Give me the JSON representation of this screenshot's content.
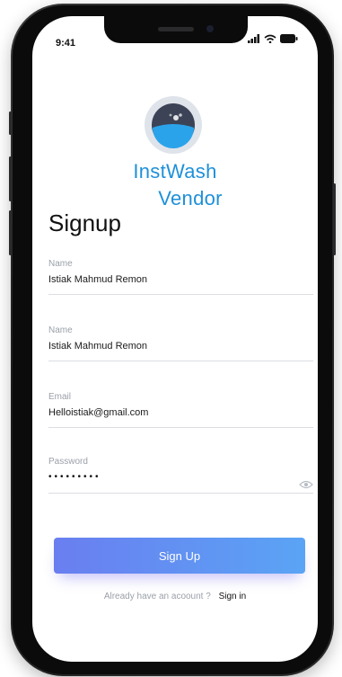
{
  "status_bar": {
    "time": "9:41"
  },
  "brand": {
    "line1": "InstWash",
    "line2": "Vendor"
  },
  "page": {
    "title": "Signup"
  },
  "fields": [
    {
      "label": "Name",
      "value": "Istiak Mahmud Remon"
    },
    {
      "label": "Name",
      "value": "Istiak Mahmud Remon"
    },
    {
      "label": "Email",
      "value": "Helloistiak@gmail.com"
    },
    {
      "label": "Password",
      "value": "•••••••••"
    }
  ],
  "actions": {
    "signup_label": "Sign Up"
  },
  "footer": {
    "prompt": "Already have an acoount ?",
    "signin_label": "Sign in"
  },
  "colors": {
    "brand": "#1e90d9",
    "button_start": "#6a7ef0",
    "button_end": "#5aa4f5"
  },
  "icons": {
    "logo": "washing-machine-icon",
    "password_toggle": "eye-icon"
  }
}
